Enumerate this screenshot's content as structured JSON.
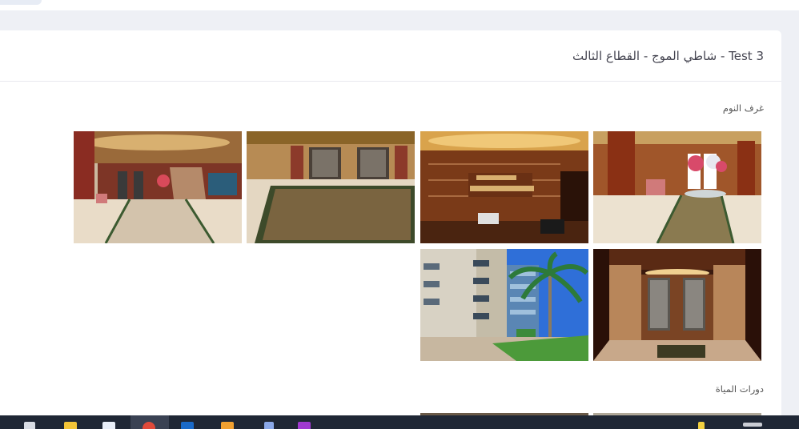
{
  "card": {
    "title": "Test 3 - شاطي الموج - القطاع الثالث"
  },
  "sections": [
    {
      "label": "غرف النوم",
      "photos": [
        {
          "icon": "hotel-lobby-photo"
        },
        {
          "icon": "elevator-hall-carpet-photo"
        },
        {
          "icon": "hotel-sign-photo"
        },
        {
          "icon": "lobby-flowers-photo"
        },
        {
          "icon": "building-palm-tree-photo"
        },
        {
          "icon": "elevator-doors-photo"
        }
      ]
    },
    {
      "label": "دورات المياة"
    }
  ],
  "taskbar": {
    "icons": [
      "start-icon",
      "file-explorer-icon",
      "briefcase-icon",
      "chrome-icon",
      "outlook-icon",
      "paint-icon",
      "notepad-icon",
      "photoshop-icon"
    ]
  }
}
